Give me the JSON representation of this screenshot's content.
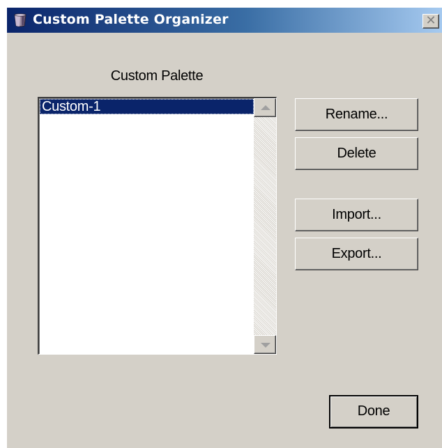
{
  "window": {
    "title": "Custom Palette Organizer",
    "close_glyph": "✕",
    "title_icon": "palette-cup-icon",
    "close_icon": "close-icon"
  },
  "palette": {
    "label": "Custom Palette",
    "items": [
      {
        "label": "Custom-1",
        "selected": true
      }
    ]
  },
  "buttons": {
    "rename": "Rename...",
    "delete": "Delete",
    "import": "Import...",
    "export": "Export...",
    "done": "Done"
  },
  "colors": {
    "dialog_bg": "#d4d0c8",
    "title_start": "#0a246a",
    "title_end": "#a6caf0",
    "selection": "#0a246a"
  }
}
